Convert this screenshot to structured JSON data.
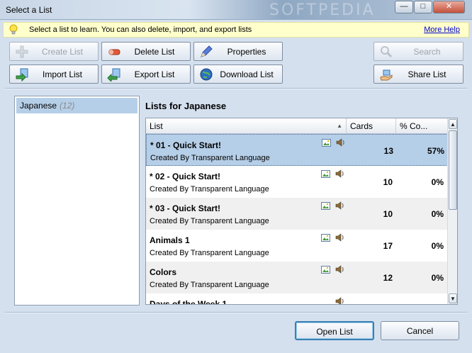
{
  "window": {
    "title": "Select a List",
    "watermark": "SOFTPEDIA"
  },
  "info_bar": {
    "message": "Select a list to learn. You can also delete, import, and export lists",
    "help_link": "More Help"
  },
  "toolbar": {
    "create_list": "Create List",
    "delete_list": "Delete List",
    "properties": "Properties",
    "import_list": "Import List",
    "export_list": "Export List",
    "download_list": "Download List",
    "search": "Search",
    "share_list": "Share List"
  },
  "languages": [
    {
      "name": "Japanese",
      "count": "(12)"
    }
  ],
  "lists_title": "Lists for Japanese",
  "grid": {
    "columns": {
      "list": "List",
      "cards": "Cards",
      "percent": "% Co..."
    },
    "rows": [
      {
        "name": "* 01 - Quick Start!",
        "creator": "Created By Transparent Language",
        "cards": "13",
        "percent": "57%"
      },
      {
        "name": "* 02 - Quick Start!",
        "creator": "Created By Transparent Language",
        "cards": "10",
        "percent": "0%"
      },
      {
        "name": "* 03 - Quick Start!",
        "creator": "Created By Transparent Language",
        "cards": "10",
        "percent": "0%"
      },
      {
        "name": "Animals 1",
        "creator": "Created By Transparent Language",
        "cards": "17",
        "percent": "0%"
      },
      {
        "name": "Colors",
        "creator": "Created By Transparent Language",
        "cards": "12",
        "percent": "0%"
      },
      {
        "name": "Days of the Week 1",
        "creator": "",
        "cards": "",
        "percent": ""
      }
    ]
  },
  "footer": {
    "open_list": "Open List",
    "cancel": "Cancel"
  },
  "colors": {
    "selection": "#b6cfe8",
    "info_bar": "#ffffcc",
    "link": "#0000cc"
  }
}
